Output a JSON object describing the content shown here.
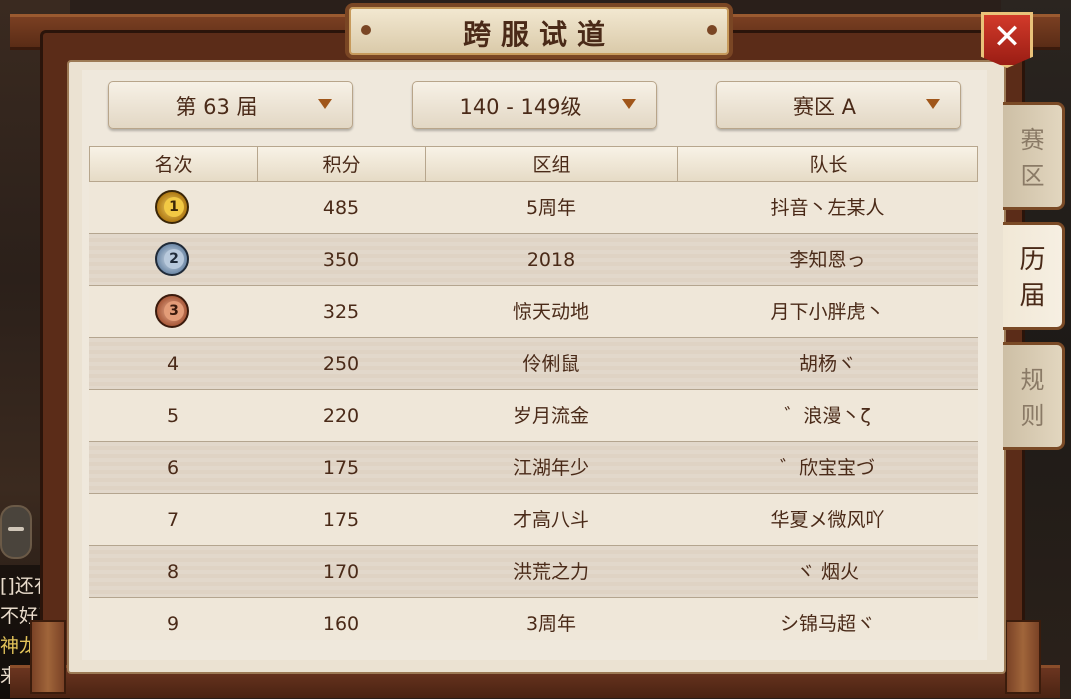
{
  "title": "跨服试道",
  "close_label": "✕",
  "filters": {
    "season": "第 63 届",
    "level": "140 - 149级",
    "zone": "赛区 A"
  },
  "table": {
    "headers": [
      "名次",
      "积分",
      "区组",
      "队长"
    ],
    "rows": [
      {
        "rank": "1",
        "medal": "gold",
        "score": "485",
        "server": "5周年",
        "captain": "抖音丶左某人"
      },
      {
        "rank": "2",
        "medal": "silver",
        "score": "350",
        "server": "2018",
        "captain": "李知恩っ"
      },
      {
        "rank": "3",
        "medal": "bronze",
        "score": "325",
        "server": "惊天动地",
        "captain": "月下小胖虎丶"
      },
      {
        "rank": "4",
        "score": "250",
        "server": "伶俐鼠",
        "captain": "胡杨ヾ"
      },
      {
        "rank": "5",
        "score": "220",
        "server": "岁月流金",
        "captain": "゛浪漫丶ζ"
      },
      {
        "rank": "6",
        "score": "175",
        "server": "江湖年少",
        "captain": "゛欣宝宝づ"
      },
      {
        "rank": "7",
        "score": "175",
        "server": "才高八斗",
        "captain": "华夏メ微风吖"
      },
      {
        "rank": "8",
        "score": "170",
        "server": "洪荒之力",
        "captain": "ヾ 烟火"
      },
      {
        "rank": "9",
        "score": "160",
        "server": "3周年",
        "captain": "シ锦马超ヾ"
      }
    ]
  },
  "side_tabs": [
    {
      "label_1": "赛",
      "label_2": "区",
      "active": false
    },
    {
      "label_1": "历",
      "label_2": "届",
      "active": true
    },
    {
      "label_1": "规",
      "label_2": "则",
      "active": false
    }
  ],
  "chat_fragments": [
    "[]还有",
    "不好了",
    "神龙",
    "来"
  ]
}
